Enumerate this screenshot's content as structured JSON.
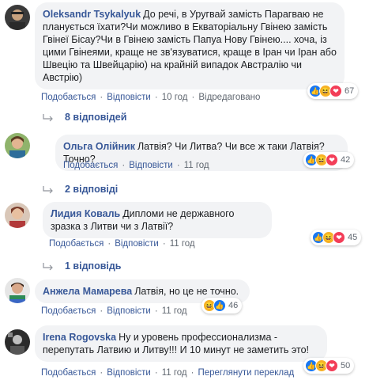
{
  "comments": [
    {
      "author": "Oleksandr Tsykalyuk",
      "text": "До речі, в Уругвай замість Парагваю не планується їхати?Чи можливо в Екваторіальну Гвінею замість Гвінеї Бісау?Чи в Гвінею замість Папуа Нову Гвінею.... хоча, із цими Гвінеями, краще не зв'язуватися, краще в Іран чи Іран або Швецію та Швейцарію) на крайній випадок Австралію чи Австрію)",
      "like_label": "Подобається",
      "reply_label": "Відповісти",
      "time": "10 год",
      "edited_label": "Відредаговано",
      "reaction_count": "67",
      "replies_label": "8 відповідей"
    },
    {
      "author": "Ольга Олійник",
      "text": "Латвія? Чи Литва? Чи все ж таки Латвія? Точно?",
      "like_label": "Подобається",
      "reply_label": "Відповісти",
      "time": "11 год",
      "reaction_count": "42",
      "replies_label": "2 відповіді"
    },
    {
      "author": "Лидия Коваль",
      "text": "Дипломи не державного зразка з Литви чи з Латвії?",
      "like_label": "Подобається",
      "reply_label": "Відповісти",
      "time": "11 год",
      "reaction_count": "45",
      "replies_label": "1 відповідь"
    },
    {
      "author": "Анжела Мамарева",
      "text": "Латвія, но це не точно.",
      "like_label": "Подобається",
      "reply_label": "Відповісти",
      "time": "11 год",
      "reaction_count": "46"
    },
    {
      "author": "Irena Rogovska",
      "text": "Ну и уровень профессионализма - перепутать Латвию и Литву!!! И 10 минут не заметить это!",
      "like_label": "Подобається",
      "reply_label": "Відповісти",
      "time": "11 год",
      "translate_label": "Переглянути переклад",
      "reaction_count": "50"
    }
  ],
  "colors": {
    "link": "#385898",
    "bubble": "#f2f3f5",
    "meta": "#606770",
    "like": "#1877f2",
    "haha": "#f7b125",
    "love": "#f33e58"
  }
}
